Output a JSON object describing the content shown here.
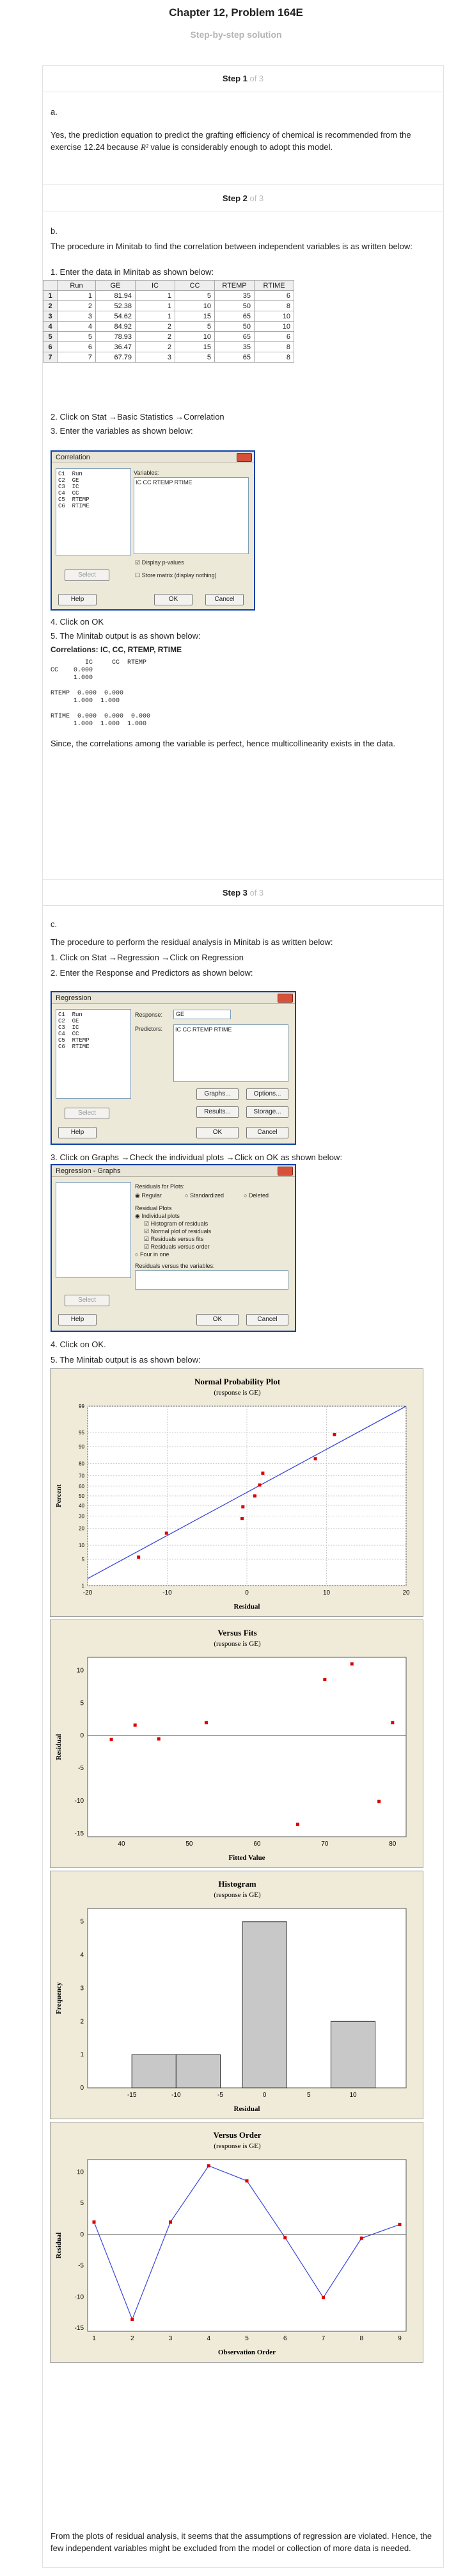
{
  "header": {
    "title": "Chapter 12, Problem 164E",
    "subtitle": "Step-by-step solution"
  },
  "step1": {
    "label": "Step 1",
    "of": " of 3",
    "part": "a.",
    "text_before": "Yes, the prediction equation to predict the grafting efficiency of chemical is recommended from the exercise 12.24 because ",
    "text_symbol": "R²",
    "text_after": " value is considerably enough to adopt this model."
  },
  "step2": {
    "label": "Step 2",
    "of": " of 3",
    "part": "b.",
    "intro": "The procedure in Minitab to find the correlation between independent variables is as written below:",
    "s1": "1. Enter the data in Minitab as shown below:",
    "table": {
      "headers": [
        "Run",
        "GE",
        "IC",
        "CC",
        "RTEMP",
        "RTIME"
      ],
      "rows": [
        [
          "1",
          "1",
          "81.94",
          "1",
          "5",
          "35",
          "6"
        ],
        [
          "2",
          "2",
          "52.38",
          "1",
          "10",
          "50",
          "8"
        ],
        [
          "3",
          "3",
          "54.62",
          "1",
          "15",
          "65",
          "10"
        ],
        [
          "4",
          "4",
          "84.92",
          "2",
          "5",
          "50",
          "10"
        ],
        [
          "5",
          "5",
          "78.93",
          "2",
          "10",
          "65",
          "6"
        ],
        [
          "6",
          "6",
          "36.47",
          "2",
          "15",
          "35",
          "8"
        ],
        [
          "7",
          "7",
          "67.79",
          "3",
          "5",
          "65",
          "8"
        ]
      ]
    },
    "s2": "2. Click on Stat →Basic Statistics →Correlation",
    "s3": "3. Enter the variables as shown below:",
    "dialog": {
      "title": "Correlation",
      "list": [
        "C1  Run",
        "C2  GE",
        "C3  IC",
        "C4  CC",
        "C5  RTEMP",
        "C6  RTIME"
      ],
      "variables_label": "Variables:",
      "variables_value": "IC CC RTEMP RTIME",
      "display_p": "Display p-values",
      "store_matrix": "Store matrix (display nothing)",
      "select": "Select",
      "help": "Help",
      "ok": "OK",
      "cancel": "Cancel"
    },
    "s4": "4. Click on OK",
    "s5": "5. The Minitab output is as shown below:",
    "output_title": "Correlations: IC, CC, RTEMP, RTIME",
    "output_lines": [
      "         IC     CC  RTEMP",
      "CC    0.000",
      "      1.000",
      "",
      "RTEMP  0.000  0.000",
      "      1.000  1.000",
      "",
      "RTIME  0.000  0.000  0.000",
      "      1.000  1.000  1.000"
    ],
    "conclusion": "Since, the correlations among the variable is perfect, hence multicollinearity exists in the data."
  },
  "step3": {
    "label": "Step 3",
    "of": " of 3",
    "part": "c.",
    "intro": "The procedure to perform the residual analysis in Minitab is as written below:",
    "s1": "1. Click on Stat →Regression →Click on Regression",
    "s2": "2. Enter the Response and Predictors as shown below:",
    "dialog": {
      "title": "Regression",
      "list": [
        "C1  Run",
        "C2  GE",
        "C3  IC",
        "C4  CC",
        "C5  RTEMP",
        "C6  RTIME"
      ],
      "response_label": "Response:",
      "response_value": "GE",
      "predictors_label": "Predictors:",
      "predictors_value": "IC CC RTEMP RTIME",
      "graphs": "Graphs...",
      "options": "Options...",
      "results": "Results...",
      "storage": "Storage...",
      "select": "Select",
      "help": "Help",
      "ok": "OK",
      "cancel": "Cancel"
    },
    "s3": "3. Click on Graphs →Check the individual plots →Click on OK as shown below:",
    "dialog2": {
      "title": "Regression - Graphs",
      "residuals_for_plots": "Residuals for Plots:",
      "regular": "Regular",
      "standardized": "Standardized",
      "deleted": "Deleted",
      "residual_plots": "Residual Plots",
      "individual": "Individual plots",
      "histogram": "Histogram of residuals",
      "normal": "Normal plot of residuals",
      "vs_fits": "Residuals versus fits",
      "vs_order": "Residuals versus order",
      "four": "Four in one",
      "vs_vars": "Residuals versus the variables:",
      "select": "Select",
      "help": "Help",
      "ok": "OK",
      "cancel": "Cancel"
    },
    "s4": "4. Click on OK.",
    "s5": "5. The Minitab output is as shown below:",
    "conclusion": "From the plots of residual analysis, it seems that the assumptions of regression are violated. Hence, the few independent variables might be excluded from the model or collection of more data is needed."
  },
  "chart_data": [
    {
      "type": "scatter",
      "title": "Normal Probability Plot",
      "subtitle": "(response is GE)",
      "xlabel": "Residual",
      "ylabel": "Percent",
      "xlim": [
        -20,
        20
      ],
      "xticks": [
        -20,
        -10,
        0,
        10,
        20
      ],
      "yticks": [
        1,
        5,
        10,
        20,
        30,
        40,
        50,
        60,
        70,
        80,
        90,
        95,
        99
      ],
      "x": [
        -13.6,
        -10.1,
        -0.6,
        -0.5,
        1.0,
        1.6,
        2.0,
        8.6,
        11.0
      ],
      "y": [
        5.6,
        16.7,
        27.8,
        38.9,
        50,
        61.1,
        72.2,
        83.3,
        94.4
      ],
      "fit_line": {
        "x": [
          -20,
          20
        ],
        "y": [
          1.6,
          99
        ]
      }
    },
    {
      "type": "scatter",
      "title": "Versus Fits",
      "subtitle": "(response is GE)",
      "xlabel": "Fitted Value",
      "ylabel": "Residual",
      "xlim": [
        35,
        82
      ],
      "ylim": [
        -15.5,
        12
      ],
      "xticks": [
        40,
        50,
        60,
        70,
        80
      ],
      "yticks": [
        -15,
        -10,
        -5,
        0,
        5,
        10
      ],
      "x": [
        38.5,
        42,
        45.5,
        52.5,
        66,
        70,
        74,
        78,
        80
      ],
      "y": [
        -0.6,
        1.6,
        -0.5,
        2.0,
        -13.6,
        8.6,
        11.0,
        -10.1,
        2.0
      ]
    },
    {
      "type": "bar",
      "title": "Histogram",
      "subtitle": "(response is GE)",
      "xlabel": "Residual",
      "ylabel": "Frequency",
      "ylim": [
        0,
        5.4
      ],
      "xticks": [
        -15,
        -10,
        -5,
        0,
        5,
        10
      ],
      "yticks": [
        0,
        1,
        2,
        3,
        4,
        5
      ],
      "bins": [
        {
          "from": -15,
          "to": -10,
          "value": 1
        },
        {
          "from": -10,
          "to": -5,
          "value": 1
        },
        {
          "from": -5,
          "to": 0,
          "value": 0
        },
        {
          "from": -2.5,
          "to": 2.5,
          "value": 5
        },
        {
          "from": 5,
          "to": 7.5,
          "value": 0
        },
        {
          "from": 7.5,
          "to": 12.5,
          "value": 2
        }
      ]
    },
    {
      "type": "line",
      "title": "Versus Order",
      "subtitle": "(response is GE)",
      "xlabel": "Observation Order",
      "ylabel": "Residual",
      "xlim": [
        1,
        9
      ],
      "ylim": [
        -15.5,
        12
      ],
      "xticks": [
        1,
        2,
        3,
        4,
        5,
        6,
        7,
        8,
        9
      ],
      "yticks": [
        -15,
        -10,
        -5,
        0,
        5,
        10
      ],
      "x": [
        1,
        2,
        3,
        4,
        5,
        6,
        7,
        8,
        9
      ],
      "y": [
        2.0,
        -13.6,
        2.0,
        11.0,
        8.6,
        -0.5,
        -10.1,
        -0.6,
        1.6
      ]
    }
  ],
  "colors": {
    "point": "#dd0000",
    "line": "#3a46d8",
    "panel": "#f0ebd8"
  }
}
